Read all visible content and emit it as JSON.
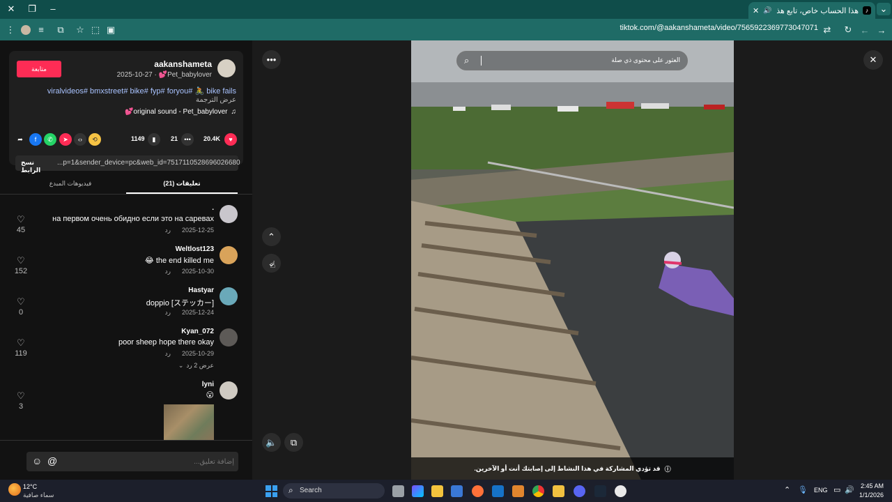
{
  "browser": {
    "tab_title": "هذا الحساب خاص، تابع هذا ال...",
    "url": "tiktok.com/@aakanshameta/video/7565922369773047071"
  },
  "post": {
    "username": "aakanshameta",
    "meta": "2025-10-27 · 💕Pet_babylover",
    "follow_label": "متابعة",
    "caption": "viralvideos# bmxstreet# bike# fyp# foryou# 🚴 bike fails",
    "translate": "عرض الترجمة",
    "sound": "💕original sound - Pet_babylover",
    "likes": "20.4K",
    "comments": "21",
    "saves": "1149",
    "link": "...p=1&sender_device=pc&web_id=7517110528696026680",
    "copy_link": "نسخ الرابط"
  },
  "tabs": {
    "comments": "(21) تعليقات",
    "creator_videos": "فيديوهات المبدع"
  },
  "comments": [
    {
      "user": ".",
      "text": "на первом очень обидно если это на саревах",
      "date": "2025-12-25",
      "reply": "رد",
      "likes": "45"
    },
    {
      "user": "Weltlost123",
      "text": "😂 the end killed me",
      "date": "2025-10-30",
      "reply": "رد",
      "likes": "152"
    },
    {
      "user": "Hastyar",
      "text": "doppio [ステッカー]",
      "date": "2025-12-24",
      "reply": "رد",
      "likes": "0"
    },
    {
      "user": "Kyan_072",
      "text": "poor sheep hope there okay",
      "date": "2025-10-29",
      "reply": "رد",
      "likes": "119",
      "more": "عرض 2 رد"
    },
    {
      "user": "lyni",
      "text": "😮",
      "likes": "3"
    }
  ],
  "comment_input": {
    "placeholder": "إضافة تعليق..."
  },
  "video": {
    "search_placeholder": "العثور على محتوى ذي صلة",
    "warning": "قد تؤدي المشاركة في هذا النشاط إلى إصابتك أنت أو الآخرين."
  },
  "taskbar": {
    "weather_temp": "12°C",
    "weather_desc": "سماء صافية",
    "search": "Search",
    "lang": "ENG",
    "time": "2:45 AM",
    "date": "1/1/2026"
  },
  "colors": {
    "accent": "#fe2c55",
    "browser": "#1f6b66"
  }
}
